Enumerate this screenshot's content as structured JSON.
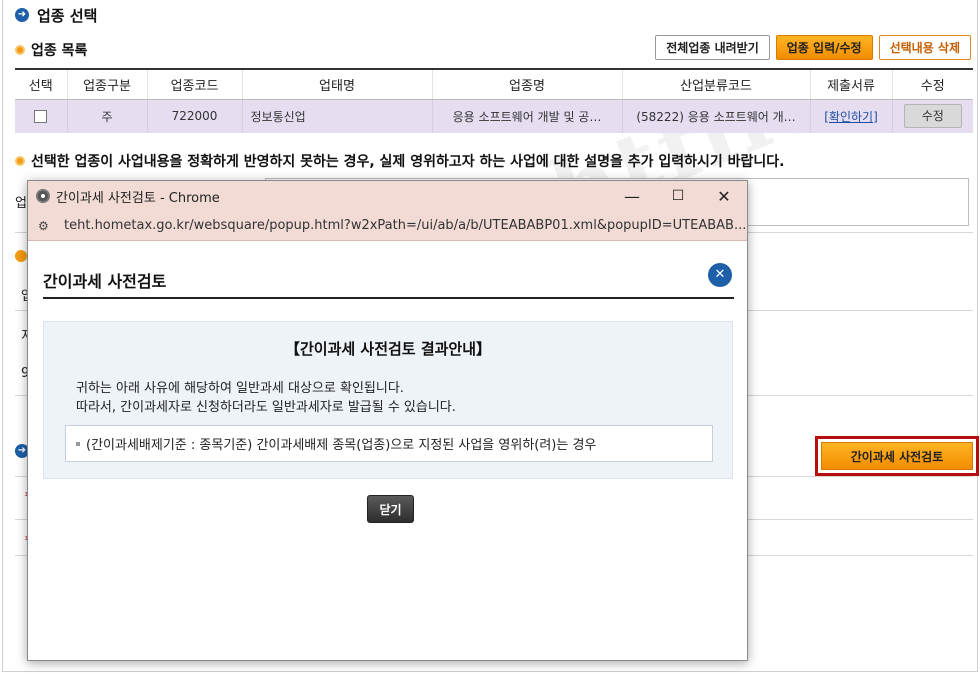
{
  "page": {
    "title": "업종 선택",
    "section_list": "업종 목록",
    "buttons": {
      "download_all": "전체업종 내려받기",
      "input_edit": "업종 입력/수정",
      "delete_selected": "선택내용 삭제"
    },
    "table": {
      "headers": [
        "선택",
        "업종구분",
        "업종코드",
        "업태명",
        "업종명",
        "산업분류코드",
        "제출서류",
        "수정"
      ],
      "row": {
        "type": "주",
        "code": "722000",
        "business_type": "정보통신업",
        "business_name": "응용 소프트웨어 개발 및 공…",
        "industry_code": "(58222) 응용 소프트웨어 개…",
        "docs_link": "[확인하기]",
        "edit_btn": "수정"
      }
    },
    "notice": "선택한 업종이 사업내용을 정확하게 반영하지 못하는 경우, 실제 영위하고자 하는 사업에 대한 설명을 추가 입력하시기 바랍니다.",
    "review_button": "간이과세 사전검토",
    "watermark": "insightfile",
    "partial_labels": [
      "업",
      "업",
      "지",
      "9"
    ]
  },
  "popup": {
    "window_title": "간이과세 사전검토 - Chrome",
    "url": "teht.hometax.go.kr/websquare/popup.html?w2xPath=/ui/ab/a/b/UTEABABP01.xml&popupID=UTEABAB...",
    "win_controls": [
      "—",
      "☐",
      "✕"
    ],
    "heading": "간이과세 사전검토",
    "result_title": "【간이과세 사전검토 결과안내】",
    "line1": "귀하는 아래 사유에 해당하여 일반과세 대상으로 확인됩니다.",
    "line2": "따라서, 간이과세자로 신청하더라도 일반과세자로 발급될 수 있습니다.",
    "reason": "(간이과세배제기준 : 종목기준) 간이과세배제 종목(업종)으로 지정된 사업을 영위하(려)는 경우",
    "close_label": "닫기"
  },
  "colors": {
    "accent_blue": "#1d5fa8",
    "orange": "#f28c00",
    "highlight_red": "#b80d0d",
    "selected_row": "#e6ddf1"
  }
}
